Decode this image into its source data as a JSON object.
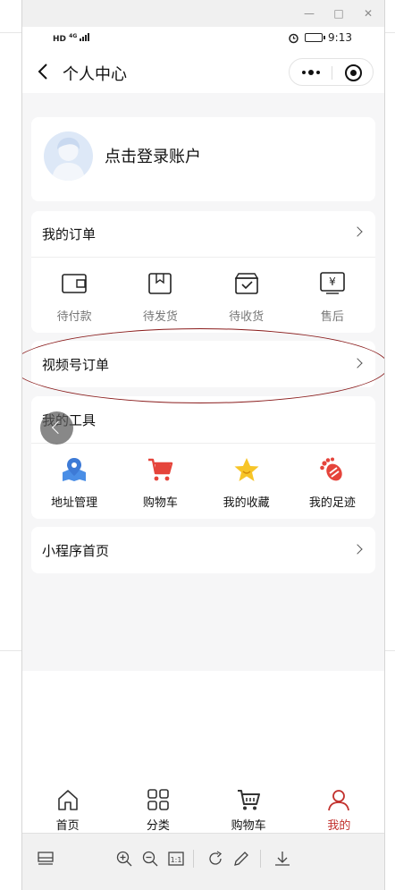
{
  "status_bar": {
    "network": "HD",
    "signal_label": "4G",
    "time": "9:13"
  },
  "nav": {
    "title": "个人中心"
  },
  "login": {
    "text": "点击登录账户"
  },
  "orders": {
    "title": "我的订单",
    "items": [
      {
        "label": "待付款",
        "icon": "wallet-icon"
      },
      {
        "label": "待发货",
        "icon": "package-icon"
      },
      {
        "label": "待收货",
        "icon": "box-check-icon"
      },
      {
        "label": "售后",
        "icon": "yen-refund-icon"
      }
    ]
  },
  "video_orders": {
    "title": "视频号订单"
  },
  "tools": {
    "title": "我的工具",
    "items": [
      {
        "label": "地址管理",
        "icon": "map-location-icon"
      },
      {
        "label": "购物车",
        "icon": "cart-icon"
      },
      {
        "label": "我的收藏",
        "icon": "star-icon"
      },
      {
        "label": "我的足迹",
        "icon": "footprint-icon"
      }
    ]
  },
  "mini_home": {
    "title": "小程序首页"
  },
  "tabbar": {
    "items": [
      {
        "label": "首页",
        "icon": "home-icon",
        "active": false
      },
      {
        "label": "分类",
        "icon": "grid-icon",
        "active": false
      },
      {
        "label": "购物车",
        "icon": "cart-icon",
        "active": false
      },
      {
        "label": "我的",
        "icon": "user-icon",
        "active": true
      }
    ]
  },
  "colors": {
    "accent": "#c2312d",
    "annotation": "#8a1c1c",
    "page_bg": "#f6f6f7"
  }
}
